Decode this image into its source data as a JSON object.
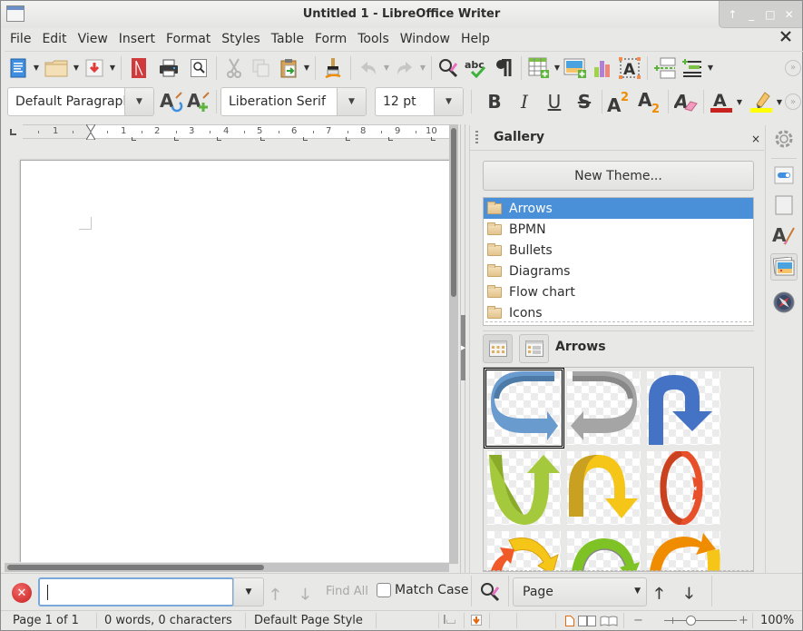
{
  "window": {
    "title": "Untitled 1 - LibreOffice Writer",
    "controls": [
      "↑",
      "_",
      "□",
      "✕"
    ]
  },
  "menubar": {
    "items": [
      "File",
      "Edit",
      "View",
      "Insert",
      "Format",
      "Styles",
      "Table",
      "Form",
      "Tools",
      "Window",
      "Help"
    ]
  },
  "toolbar_standard": {
    "icons": [
      "new-document",
      "open",
      "save",
      "export-pdf",
      "print",
      "print-preview",
      "cut",
      "copy",
      "paste",
      "clone-formatting",
      "undo",
      "redo",
      "find-replace",
      "spelling",
      "formatting-marks",
      "insert-table",
      "insert-image",
      "insert-chart",
      "insert-text-box",
      "insert-page-break",
      "insert-field"
    ]
  },
  "toolbar_formatting": {
    "paragraph_style": "Default Paragraph Style",
    "font_name": "Liberation Serif",
    "font_size": "12 pt",
    "bold": "B",
    "italic": "I",
    "underline": "U",
    "strikethrough": "S",
    "font_color": "#c9211e",
    "highlight_color": "#ffff00"
  },
  "ruler": {
    "left_label": "1",
    "labels": [
      "1",
      "2",
      "3",
      "4",
      "5",
      "6",
      "7",
      "8",
      "9",
      "10"
    ]
  },
  "sidebar": {
    "title": "Gallery",
    "close": "×",
    "new_theme_button": "New Theme...",
    "themes": [
      {
        "label": "Arrows",
        "selected": true
      },
      {
        "label": "BPMN",
        "selected": false
      },
      {
        "label": "Bullets",
        "selected": false
      },
      {
        "label": "Diagrams",
        "selected": false
      },
      {
        "label": "Flow chart",
        "selected": false
      },
      {
        "label": "Icons",
        "selected": false
      }
    ],
    "current_theme": "Arrows",
    "items": [
      {
        "name": "circular-arrow-blue",
        "color": "#6a9bcf"
      },
      {
        "name": "circular-arrow-gray",
        "color": "#9a9a9a"
      },
      {
        "name": "u-turn-arrow-blue",
        "color": "#4472c4"
      },
      {
        "name": "u-arrow-green",
        "color": "#a5c93c"
      },
      {
        "name": "arch-arrow-yellow",
        "color": "#f5c518"
      },
      {
        "name": "oval-arrows-red",
        "color": "#e8502a"
      },
      {
        "name": "circle-arrows-orange-yellow",
        "color": "#f5a623"
      },
      {
        "name": "circle-arrow-green",
        "color": "#7ec225"
      },
      {
        "name": "circle-arrow-orange",
        "color": "#f08c00"
      }
    ],
    "tabs": [
      "properties",
      "styles",
      "page",
      "manage-changes",
      "gallery",
      "navigator"
    ]
  },
  "findbar": {
    "search_value": "",
    "find_all": "Find All",
    "match_case": "Match Case",
    "match_case_checked": false,
    "navigate_by": "Page"
  },
  "statusbar": {
    "page": "Page 1 of 1",
    "word_count": "0 words, 0 characters",
    "page_style": "Default Page Style",
    "zoom": "100%",
    "zoom_minus": "−",
    "zoom_plus": "+"
  }
}
